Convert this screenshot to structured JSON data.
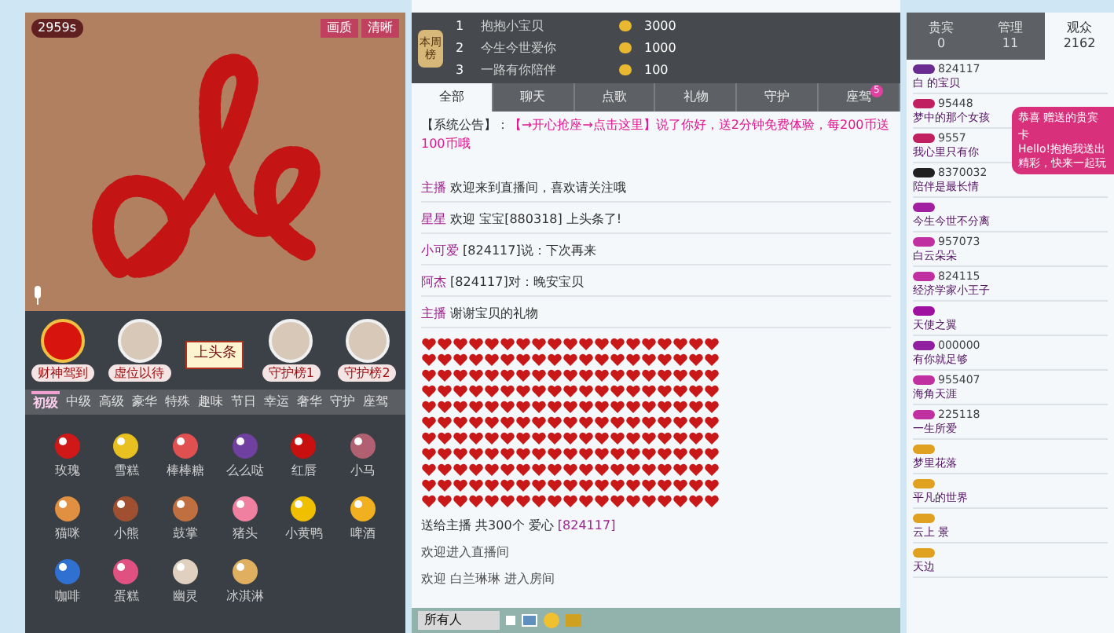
{
  "video": {
    "live_badge": "2959s",
    "buttons": [
      "画质",
      "清晰"
    ]
  },
  "stage": [
    {
      "kind": "badge",
      "label": "财神驾到"
    },
    {
      "kind": "avatar",
      "label": "虚位以待"
    },
    {
      "kind": "sign",
      "label": "上头条"
    },
    {
      "kind": "avatar",
      "label": "守护榜1"
    },
    {
      "kind": "avatar",
      "label": "守护榜2"
    }
  ],
  "gift_tabs": [
    {
      "label": "初级",
      "selected": true
    },
    {
      "label": "中级",
      "selected": false
    },
    {
      "label": "高级",
      "selected": false
    },
    {
      "label": "豪华",
      "selected": false
    },
    {
      "label": "特殊",
      "selected": false
    },
    {
      "label": "趣味",
      "selected": false
    },
    {
      "label": "节日",
      "selected": false
    },
    {
      "label": "幸运",
      "selected": false
    },
    {
      "label": "奢华",
      "selected": false
    },
    {
      "label": "守护",
      "selected": false
    },
    {
      "label": "座驾",
      "selected": false
    }
  ],
  "gifts": [
    {
      "label": "玫瑰",
      "color": "#d01818"
    },
    {
      "label": "雪糕",
      "color": "#e8c020"
    },
    {
      "label": "棒棒糖",
      "color": "#e05050"
    },
    {
      "label": "么么哒",
      "color": "#7040a0"
    },
    {
      "label": "红唇",
      "color": "#c81010"
    },
    {
      "label": "小马",
      "color": "#b06070"
    },
    {
      "label": "猫咪",
      "color": "#e09040"
    },
    {
      "label": "小熊",
      "color": "#a05030"
    },
    {
      "label": "鼓掌",
      "color": "#c07040"
    },
    {
      "label": "猪头",
      "color": "#f080a0"
    },
    {
      "label": "小黄鸭",
      "color": "#f0c000"
    },
    {
      "label": "啤酒",
      "color": "#f0b020"
    },
    {
      "label": "咖啡",
      "color": "#3070d0"
    },
    {
      "label": "蛋糕",
      "color": "#e05080"
    },
    {
      "label": "幽灵",
      "color": "#e0d0c0"
    },
    {
      "label": "冰淇淋",
      "color": "#e0b060"
    }
  ],
  "rank": {
    "title": "本周榜",
    "rows": [
      {
        "rank": "1",
        "name": "抱抱小宝贝",
        "value": "3000"
      },
      {
        "rank": "2",
        "name": "今生今世爱你",
        "value": "1000"
      },
      {
        "rank": "3",
        "name": "一路有你陪伴",
        "value": "100"
      }
    ]
  },
  "chat_tabs": [
    {
      "label": "全部",
      "selected": true
    },
    {
      "label": "聊天",
      "selected": false
    },
    {
      "label": "点歌",
      "selected": false
    },
    {
      "label": "礼物",
      "selected": false
    },
    {
      "label": "守护",
      "selected": false
    },
    {
      "label": "座驾",
      "selected": false,
      "badge": "5"
    }
  ],
  "announcement": {
    "label": "【系统公告】：",
    "text": "【→开心抢座→点击这里】说了你好，送2分钟免费体验，每200币送100币哦"
  },
  "messages": [
    {
      "user": "主播",
      "text": "欢迎来到直播间，喜欢请关注哦"
    },
    {
      "user": "星星",
      "text": "欢迎 宝宝[880318] 上头条了!"
    },
    {
      "user": "小可爱",
      "text": "[824117]说：下次再来"
    },
    {
      "user": "阿杰",
      "text": "[824117]对：晚安宝贝"
    },
    {
      "user": "主播",
      "text": "谢谢宝贝的礼物"
    }
  ],
  "hearts_message": {
    "text": "送给主播 共300个 爱心",
    "sender": "[824117]"
  },
  "system_messages": [
    "欢迎进入直播间",
    "欢迎 白兰琳琳 进入房间"
  ],
  "input": {
    "target": "所有人"
  },
  "user_tabs": [
    {
      "label": "贵宾",
      "count": "0",
      "selected": false
    },
    {
      "label": "管理",
      "count": "11",
      "selected": false
    },
    {
      "label": "观众",
      "count": "2162",
      "selected": true
    }
  ],
  "users": [
    {
      "id": "824117",
      "name": "白 的宝贝",
      "color": "#6a2b90"
    },
    {
      "id": "95448",
      "name": "梦中的那个女孩",
      "color": "#c02060"
    },
    {
      "id": "9557",
      "name": "我心里只有你",
      "color": "#c02060"
    },
    {
      "id": "8370032",
      "name": "陪伴是最长情",
      "color": "#202020"
    },
    {
      "name": "今生今世不分离",
      "color": "#a020a0"
    },
    {
      "id": "957073",
      "name": "白云朵朵",
      "color": "#c030a0"
    },
    {
      "id": "824115",
      "name": "经济学家小王子",
      "color": "#c030a0"
    },
    {
      "name": "天使之翼",
      "color": "#a010a0"
    },
    {
      "id": "000000",
      "name": "有你就足够",
      "color": "#9020a0"
    },
    {
      "id": "955407",
      "name": "海角天涯",
      "color": "#c030a0"
    },
    {
      "id": "225118",
      "name": "一生所爱",
      "color": "#c030a0"
    },
    {
      "name": "梦里花落",
      "color": "#e0a020"
    },
    {
      "name": "平凡的世界",
      "color": "#e0a020"
    },
    {
      "name": "云上 景",
      "color": "#e0a020"
    },
    {
      "name": "天边",
      "color": "#e0a020"
    }
  ],
  "popup": {
    "title": "恭喜 赠送的贵宾卡",
    "text": "Hello!抱抱我送出精彩，快来一起玩"
  }
}
